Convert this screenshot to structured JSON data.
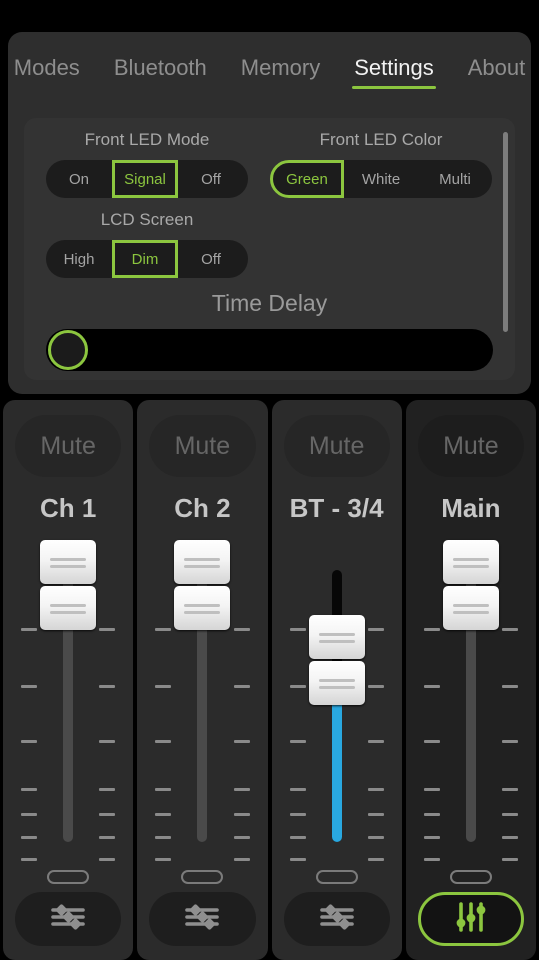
{
  "colors": {
    "accent_green": "#8cc63f",
    "bt_fader_blue": "#29a8e0",
    "page_background": "#000000",
    "panel_background": "#2e2e2e",
    "card_background": "#333333",
    "strip_background": "#2b2b2b",
    "text_muted": "#8e8e8e",
    "text_primary": "#f2f2f2"
  },
  "tabs": [
    {
      "label": "Modes",
      "active": false
    },
    {
      "label": "Bluetooth",
      "active": false
    },
    {
      "label": "Memory",
      "active": false
    },
    {
      "label": "Settings",
      "active": true
    },
    {
      "label": "About",
      "active": false
    }
  ],
  "settings": {
    "front_led_mode": {
      "label": "Front LED Mode",
      "options": [
        "On",
        "Signal",
        "Off"
      ],
      "selected": "Signal",
      "selected_index": 1
    },
    "front_led_color": {
      "label": "Front LED Color",
      "options": [
        "Green",
        "White",
        "Multi"
      ],
      "selected": "Green",
      "selected_index": 0
    },
    "lcd_screen": {
      "label": "LCD Screen",
      "options": [
        "High",
        "Dim",
        "Off"
      ],
      "selected": "Dim",
      "selected_index": 1
    },
    "time_delay": {
      "label": "Time Delay",
      "value_percent": 0
    },
    "scrollbar": {
      "thumb_percent": 85
    }
  },
  "mixer": {
    "channels": [
      {
        "name": "Ch 1",
        "mute_label": "Mute",
        "muted": false,
        "fader_fill_color": "none",
        "fader_position_percent": 100,
        "settings_icon": "horizontal-sliders-icon",
        "settings_active": false
      },
      {
        "name": "Ch 2",
        "mute_label": "Mute",
        "muted": false,
        "fader_fill_color": "none",
        "fader_position_percent": 100,
        "settings_icon": "horizontal-sliders-icon",
        "settings_active": false
      },
      {
        "name": "BT - 3/4",
        "mute_label": "Mute",
        "muted": false,
        "fader_fill_color": "#29a8e0",
        "fader_position_percent": 70,
        "settings_icon": "horizontal-sliders-icon",
        "settings_active": false
      },
      {
        "name": "Main",
        "mute_label": "Mute",
        "muted": false,
        "fader_fill_color": "none",
        "fader_position_percent": 100,
        "settings_icon": "vertical-sliders-icon",
        "settings_active": true
      }
    ]
  }
}
